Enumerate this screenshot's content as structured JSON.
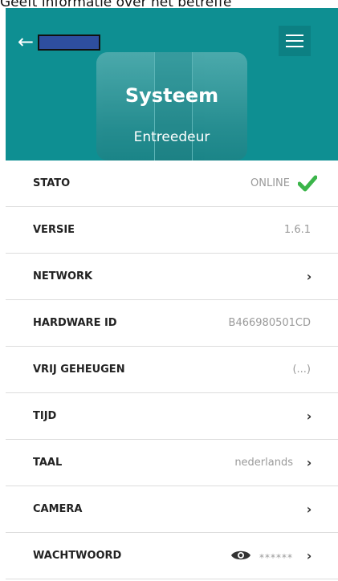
{
  "caption": "Geeft informatie over het betreffe",
  "header": {
    "title": "Systeem",
    "subtitle": "Entreedeur"
  },
  "rows": [
    {
      "label": "STATO",
      "value": "ONLINE"
    },
    {
      "label": "VERSIE",
      "value": "1.6.1"
    },
    {
      "label": "NETWORK",
      "value": ""
    },
    {
      "label": "HARDWARE ID",
      "value": "B466980501CD"
    },
    {
      "label": "VRIJ GEHEUGEN",
      "value": "(...)"
    },
    {
      "label": "TIJD",
      "value": ""
    },
    {
      "label": "TAAL",
      "value": "nederlands"
    },
    {
      "label": "CAMERA",
      "value": ""
    },
    {
      "label": "WACHTWOORD",
      "value": "******"
    }
  ],
  "colors": {
    "header_bg": "#0e8f92",
    "check": "#3bb54a",
    "redaction": "#2e4e9f"
  }
}
